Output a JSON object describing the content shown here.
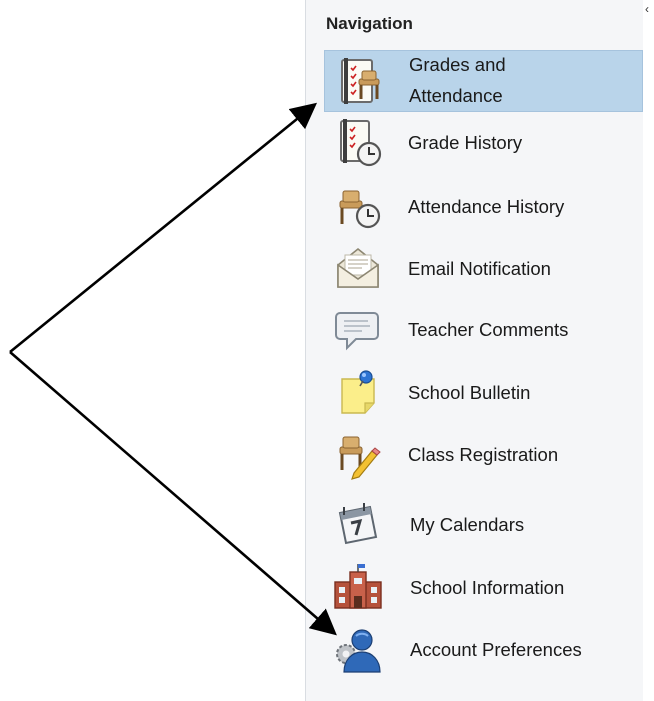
{
  "nav": {
    "heading": "Navigation",
    "items": [
      {
        "line1": "Grades and",
        "line2": "Attendance",
        "icon": "grades-attendance-icon",
        "active": true
      },
      {
        "label": "Grade History",
        "icon": "grade-history-icon"
      },
      {
        "label": "Attendance History",
        "icon": "attendance-history-icon"
      },
      {
        "label": "Email Notification",
        "icon": "email-envelope-icon"
      },
      {
        "label": "Teacher Comments",
        "icon": "speech-bubble-icon"
      },
      {
        "label": "School Bulletin",
        "icon": "sticky-note-pin-icon"
      },
      {
        "label": "Class Registration",
        "icon": "desk-pencil-icon"
      },
      {
        "label": "My Calendars",
        "icon": "calendar-icon"
      },
      {
        "label": "School Information",
        "icon": "school-building-icon"
      },
      {
        "label": "Account Preferences",
        "icon": "user-gear-icon"
      }
    ]
  },
  "colors": {
    "active_bg": "#b9d4ea",
    "panel_bg": "#f5f6f8",
    "arrow": "#000000"
  }
}
